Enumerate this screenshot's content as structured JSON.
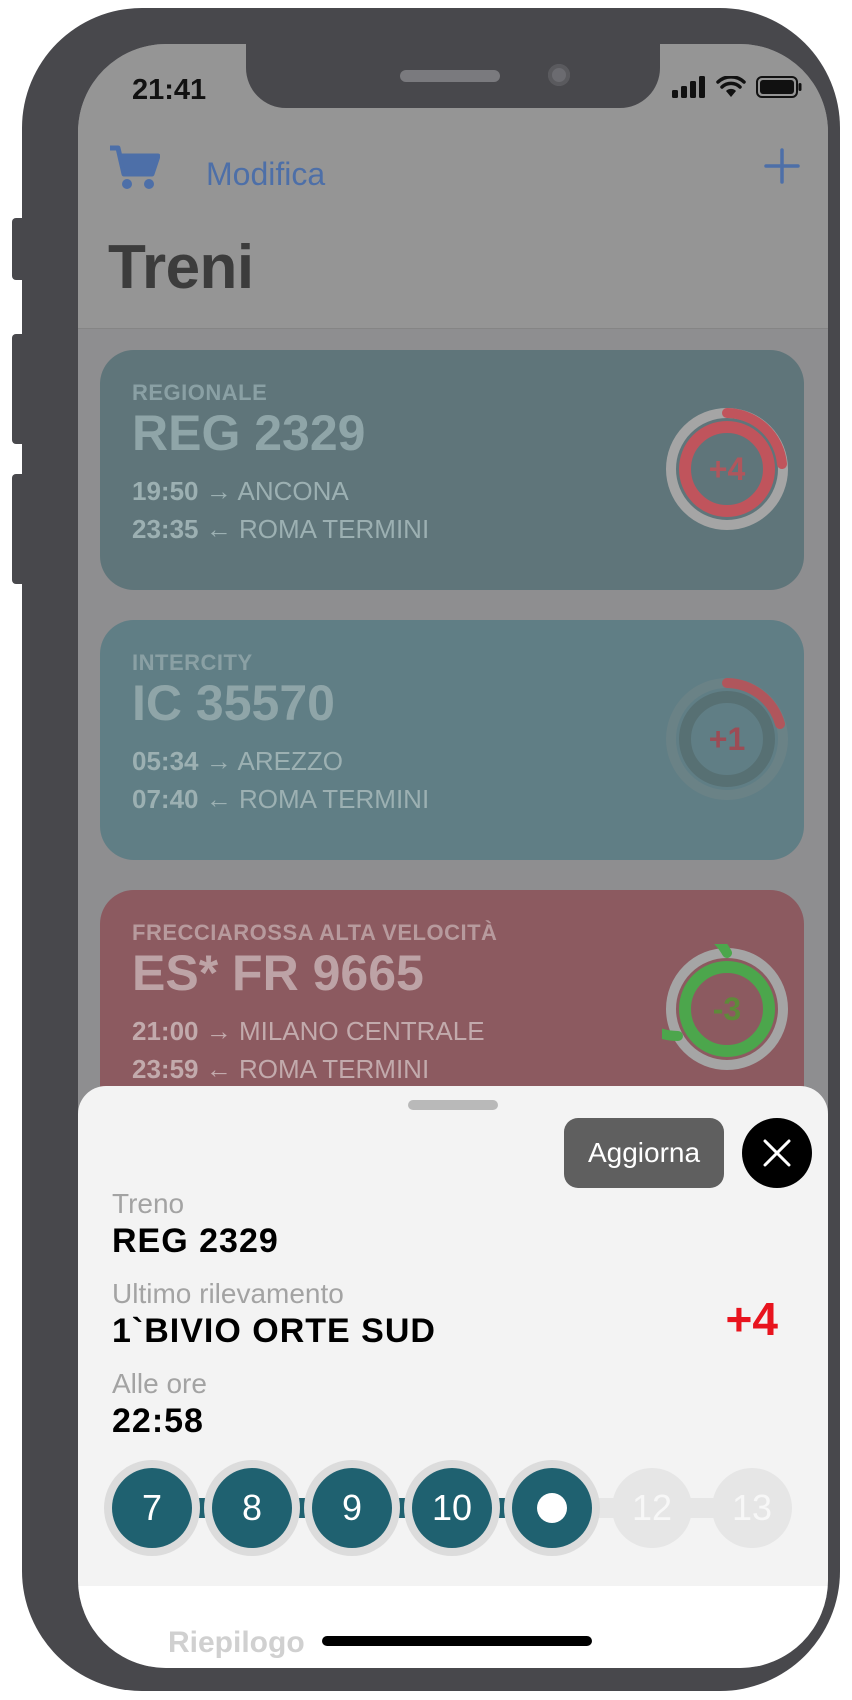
{
  "status_bar": {
    "time": "21:41"
  },
  "header": {
    "edit_label": "Modifica",
    "title": "Treni"
  },
  "trains": [
    {
      "type": "REGIONALE",
      "number": "REG 2329",
      "depart_time": "19:50",
      "depart_arrow": "→",
      "depart_dest": "ANCONA",
      "return_time": "23:35",
      "return_arrow": "←",
      "return_origin": "ROMA TERMINI",
      "delay": "+4",
      "color": "#5f757a",
      "ring_color": "#c0545c"
    },
    {
      "type": "INTERCITY",
      "number": "IC 35570",
      "depart_time": "05:34",
      "depart_arrow": "→",
      "depart_dest": "AREZZO",
      "return_time": "07:40",
      "return_arrow": "←",
      "return_origin": "ROMA TERMINI",
      "delay": "+1",
      "color": "#607e85",
      "ring_color": "#c0545c"
    },
    {
      "type": "FRECCIAROSSA ALTA VELOCITÀ",
      "number": "ES* FR 9665",
      "depart_time": "21:00",
      "depart_arrow": "→",
      "depart_dest": "MILANO CENTRALE",
      "return_time": "23:59",
      "return_arrow": "←",
      "return_origin": "ROMA TERMINI",
      "delay": "-3",
      "color": "#8c5a60",
      "ring_color": "#4ca64c"
    }
  ],
  "sheet": {
    "refresh_label": "Aggiorna",
    "train_label": "Treno",
    "train_value": "REG 2329",
    "last_label": "Ultimo rilevamento",
    "last_value": "1`BIVIO ORTE SUD",
    "time_label": "Alle ore",
    "time_value": "22:58",
    "delay": "+4",
    "stops": [
      "7",
      "8",
      "9",
      "10",
      "",
      "12",
      "13"
    ],
    "peek": "Riepilogo"
  }
}
